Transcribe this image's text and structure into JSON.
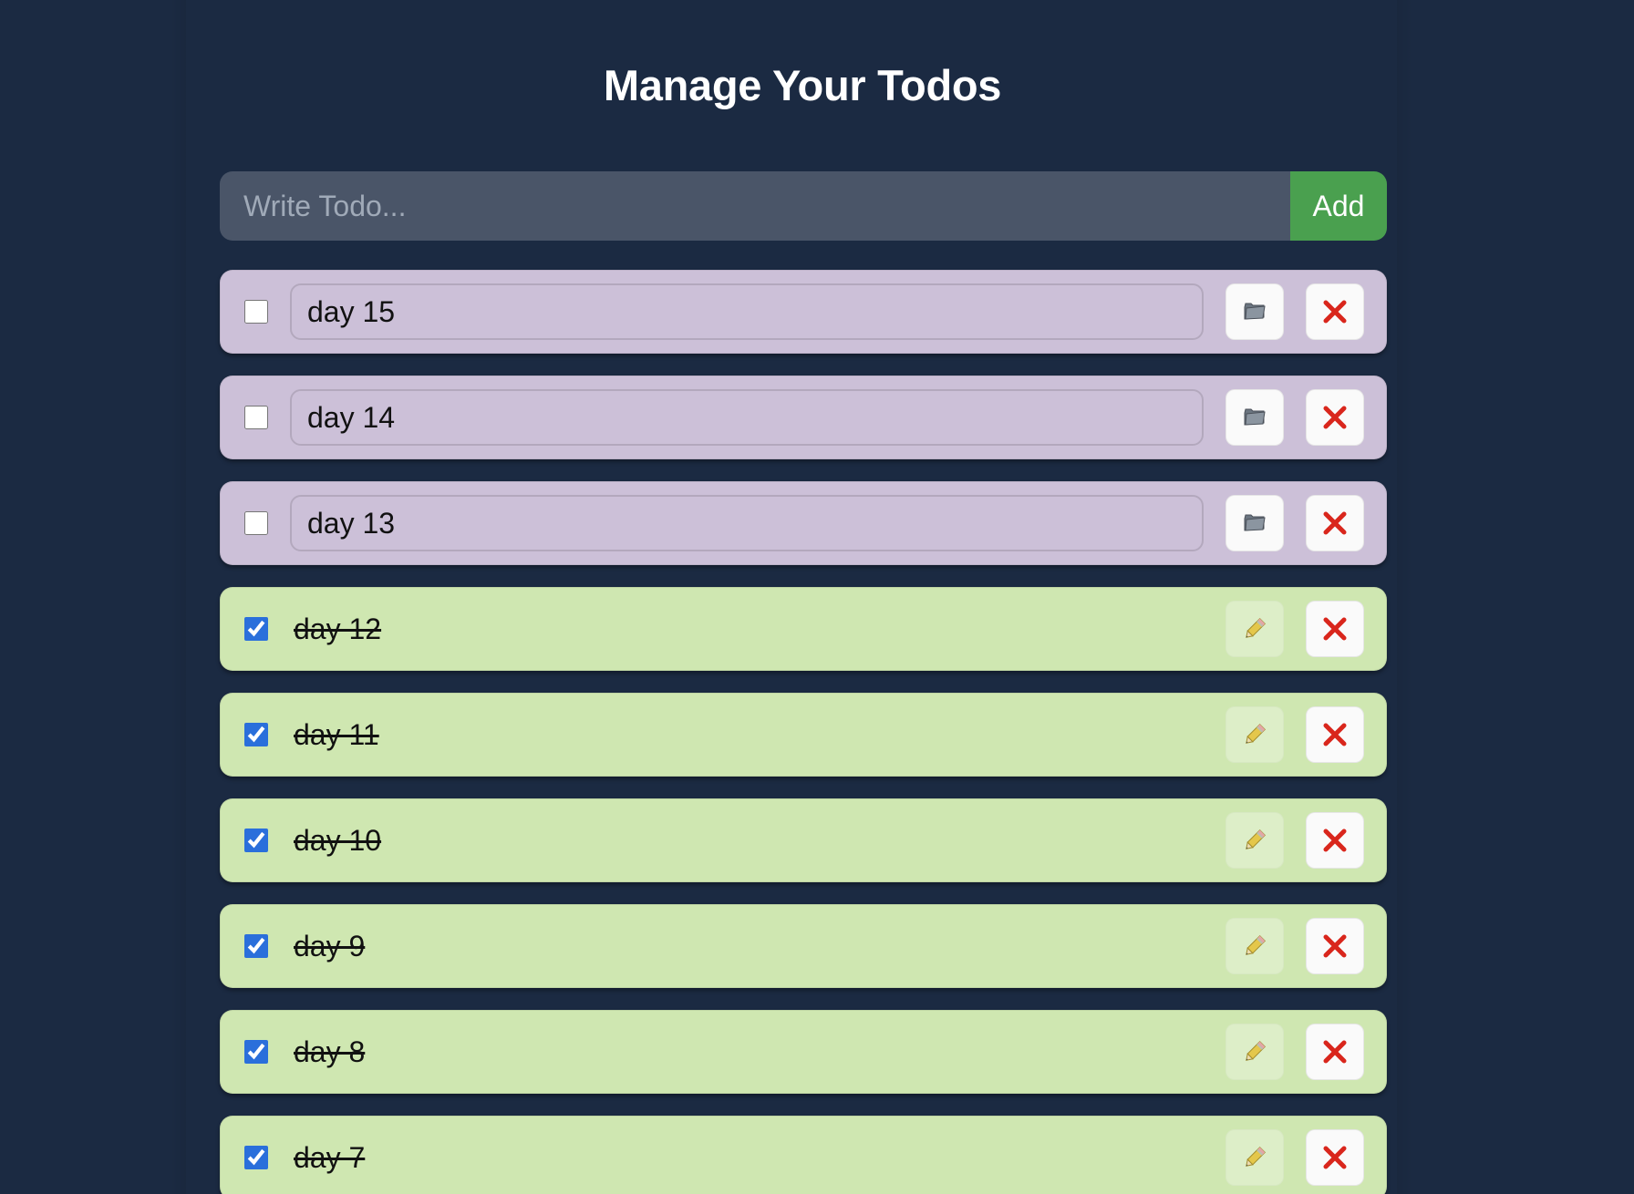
{
  "title": "Manage Your Todos",
  "add_form": {
    "placeholder": "Write Todo...",
    "button_label": "Add"
  },
  "colors": {
    "background": "#1b2a42",
    "pending_item": "#ccc0d8",
    "done_item": "#cfe7b1",
    "add_button": "#4aa04f",
    "delete_icon": "#d9261c"
  },
  "todos": [
    {
      "text": "day 15",
      "completed": false,
      "edit_icon": "folder-icon"
    },
    {
      "text": "day 14",
      "completed": false,
      "edit_icon": "folder-icon"
    },
    {
      "text": "day 13",
      "completed": false,
      "edit_icon": "folder-icon"
    },
    {
      "text": "day 12",
      "completed": true,
      "edit_icon": "pencil-icon"
    },
    {
      "text": "day 11",
      "completed": true,
      "edit_icon": "pencil-icon"
    },
    {
      "text": "day 10",
      "completed": true,
      "edit_icon": "pencil-icon"
    },
    {
      "text": "day 9",
      "completed": true,
      "edit_icon": "pencil-icon"
    },
    {
      "text": "day 8",
      "completed": true,
      "edit_icon": "pencil-icon"
    },
    {
      "text": "day 7",
      "completed": true,
      "edit_icon": "pencil-icon"
    }
  ]
}
